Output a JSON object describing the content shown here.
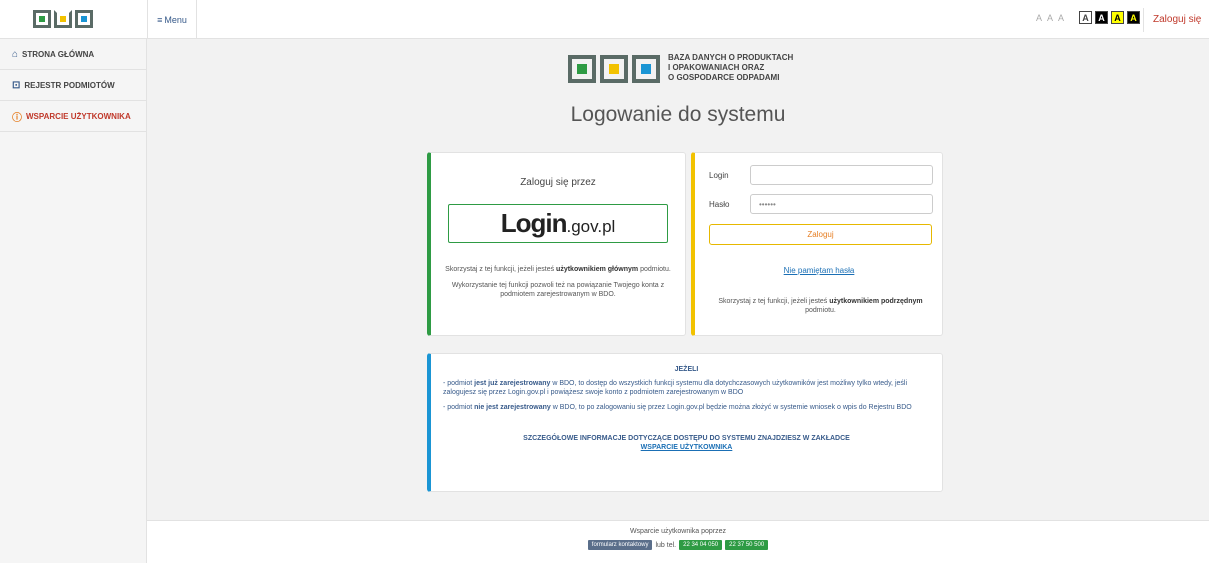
{
  "header": {
    "menu_label": "Menu",
    "font_sizes": [
      "A",
      "A",
      "A"
    ],
    "contrast_options": [
      "A",
      "A",
      "A",
      "A"
    ],
    "login_link": "Zaloguj się"
  },
  "sidebar": {
    "items": [
      {
        "label": "STRONA GŁÓWNA",
        "icon": "home-icon"
      },
      {
        "label": "REJESTR PODMIOTÓW",
        "icon": "box-icon"
      },
      {
        "label": "WSPARCIE UŻYTKOWNIKA",
        "icon": "help-icon"
      }
    ]
  },
  "brand": {
    "line1": "BAZA DANYCH O PRODUKTACH",
    "line2": "I OPAKOWANIACH ORAZ",
    "line3": "O GOSPODARCE ODPADAMI"
  },
  "page_title": "Logowanie do systemu",
  "login_gov": {
    "via_text": "Zaloguj się przez",
    "button_main": "Login",
    "button_suffix": ".gov.pl",
    "p1_before": "Skorzystaj z tej funkcji, jeżeli jesteś ",
    "p1_bold": "użytkownikiem głównym",
    "p1_after": " podmiotu.",
    "p2": "Wykorzystanie tej funkcji pozwoli też na powiązanie Twojego konta z podmiotem zarejestrowanym w BDO."
  },
  "login_form": {
    "login_label": "Login",
    "login_value": "",
    "password_label": "Hasło",
    "password_value": "••••••",
    "submit_label": "Zaloguj",
    "forgot_label": "Nie pamiętam hasła",
    "sub_before": "Skorzystaj z tej funkcji, jeżeli jesteś ",
    "sub_bold": "użytkownikiem podrzędnym",
    "sub_after": " podmiotu."
  },
  "info": {
    "title": "JEŻELI",
    "p1_a": "- podmiot ",
    "p1_bold": "jest już zarejestrowany",
    "p1_b": " w BDO, to dostęp do wszystkich funkcji systemu dla dotychczasowych użytkowników jest możliwy tylko wtedy, jeśli zalogujesz się przez Login.gov.pl i powiążesz swoje konto z podmiotem zarejestrowanym w BDO",
    "p2_a": "- podmiot ",
    "p2_bold": "nie jest zarejestrowany",
    "p2_b": " w BDO, to po zalogowaniu się przez Login.gov.pl będzie można złożyć w systemie wniosek o wpis do Rejestru BDO",
    "more_text": "SZCZEGÓŁOWE INFORMACJE DOTYCZĄCE DOSTĘPU DO SYSTEMU ZNAJDZIESZ W ZAKŁADCE",
    "more_link": "WSPARCIE UŻYTKOWNIKA"
  },
  "footer": {
    "text": "Wsparcie użytkownika poprzez",
    "contact_button": "formularz kontaktowy",
    "or_tel": "lub tel.",
    "phone1": "22 34 04 050",
    "phone2": "22 37 50 500"
  }
}
